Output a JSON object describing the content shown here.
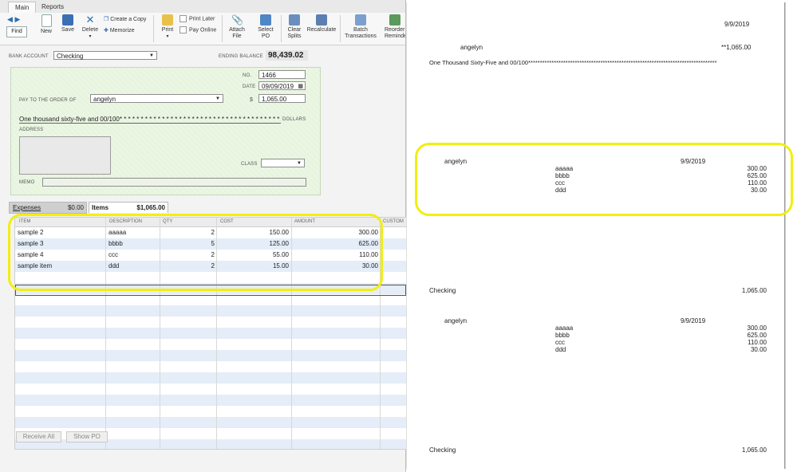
{
  "tabs": [
    "Main",
    "Reports"
  ],
  "toolbar": {
    "find": "Find",
    "new": "New",
    "save": "Save",
    "delete": "Delete",
    "create_copy": "Create a Copy",
    "memorize": "Memorize",
    "print": "Print",
    "print_later": "Print Later",
    "pay_online": "Pay Online",
    "attach_file": [
      "Attach",
      "File"
    ],
    "select_po": [
      "Select",
      "PO"
    ],
    "clear_splits": [
      "Clear",
      "Splits"
    ],
    "recalculate": "Recalculate",
    "batch_transactions": [
      "Batch",
      "Transactions"
    ],
    "reorder_reminder": [
      "Reorder",
      "Reminder"
    ]
  },
  "bank": {
    "label": "BANK ACCOUNT",
    "account": "Checking",
    "ending_label": "ENDING BALANCE",
    "ending_balance": "98,439.02"
  },
  "check": {
    "no_label": "NO.",
    "no": "1466",
    "date_label": "DATE",
    "date": "09/09/2019",
    "pay_to_label": "PAY TO THE ORDER OF",
    "payee": "angelyn",
    "dollar_sign": "$",
    "amount": "1,065.00",
    "amount_words": "One thousand sixty-five and 00/100* * * * * * * * * * * * * * * * * * * * * * * * * * * * * * * * * * * * * * *",
    "dollars_label": "DOLLARS",
    "address_label": "ADDRESS",
    "class_label": "CLASS",
    "memo_label": "MEMO"
  },
  "subtabs": {
    "expenses_label": "Expenses",
    "expenses_amount": "$0.00",
    "items_label": "Items",
    "items_amount": "$1,065.00"
  },
  "grid": {
    "headers": [
      "ITEM",
      "DESCRIPTION",
      "QTY",
      "COST",
      "AMOUNT",
      "CUSTOM"
    ],
    "rows": [
      {
        "item": "sample 2",
        "desc": "aaaaa",
        "qty": "2",
        "cost": "150.00",
        "amount": "300.00"
      },
      {
        "item": "sample 3",
        "desc": "bbbb",
        "qty": "5",
        "cost": "125.00",
        "amount": "625.00"
      },
      {
        "item": "sample 4",
        "desc": "ccc",
        "qty": "2",
        "cost": "55.00",
        "amount": "110.00"
      },
      {
        "item": "sample item",
        "desc": "ddd",
        "qty": "2",
        "cost": "15.00",
        "amount": "30.00"
      }
    ]
  },
  "buttons": {
    "receive_all": "Receive All",
    "show_po": "Show PO"
  },
  "preview": {
    "date": "9/9/2019",
    "payee": "angelyn",
    "amount_stars": "**1,065.00",
    "amount_words": "One Thousand Sixty-Five and 00/100*********************************************************************************",
    "stub1": {
      "payee": "angelyn",
      "date": "9/9/2019",
      "lines": [
        {
          "desc": "aaaaa",
          "amount": "300.00"
        },
        {
          "desc": "bbbb",
          "amount": "625.00"
        },
        {
          "desc": "ccc",
          "amount": "110.00"
        },
        {
          "desc": "ddd",
          "amount": "30.00"
        }
      ],
      "account": "Checking",
      "total": "1,065.00"
    },
    "stub2": {
      "payee": "angelyn",
      "date": "9/9/2019",
      "lines": [
        {
          "desc": "aaaaa",
          "amount": "300.00"
        },
        {
          "desc": "bbbb",
          "amount": "625.00"
        },
        {
          "desc": "ccc",
          "amount": "110.00"
        },
        {
          "desc": "ddd",
          "amount": "30.00"
        }
      ],
      "account": "Checking",
      "total": "1,065.00"
    }
  },
  "colors": {
    "highlight": "#f2ee10",
    "check_bg": "#e7f4de",
    "accent": "#2a6db0"
  }
}
